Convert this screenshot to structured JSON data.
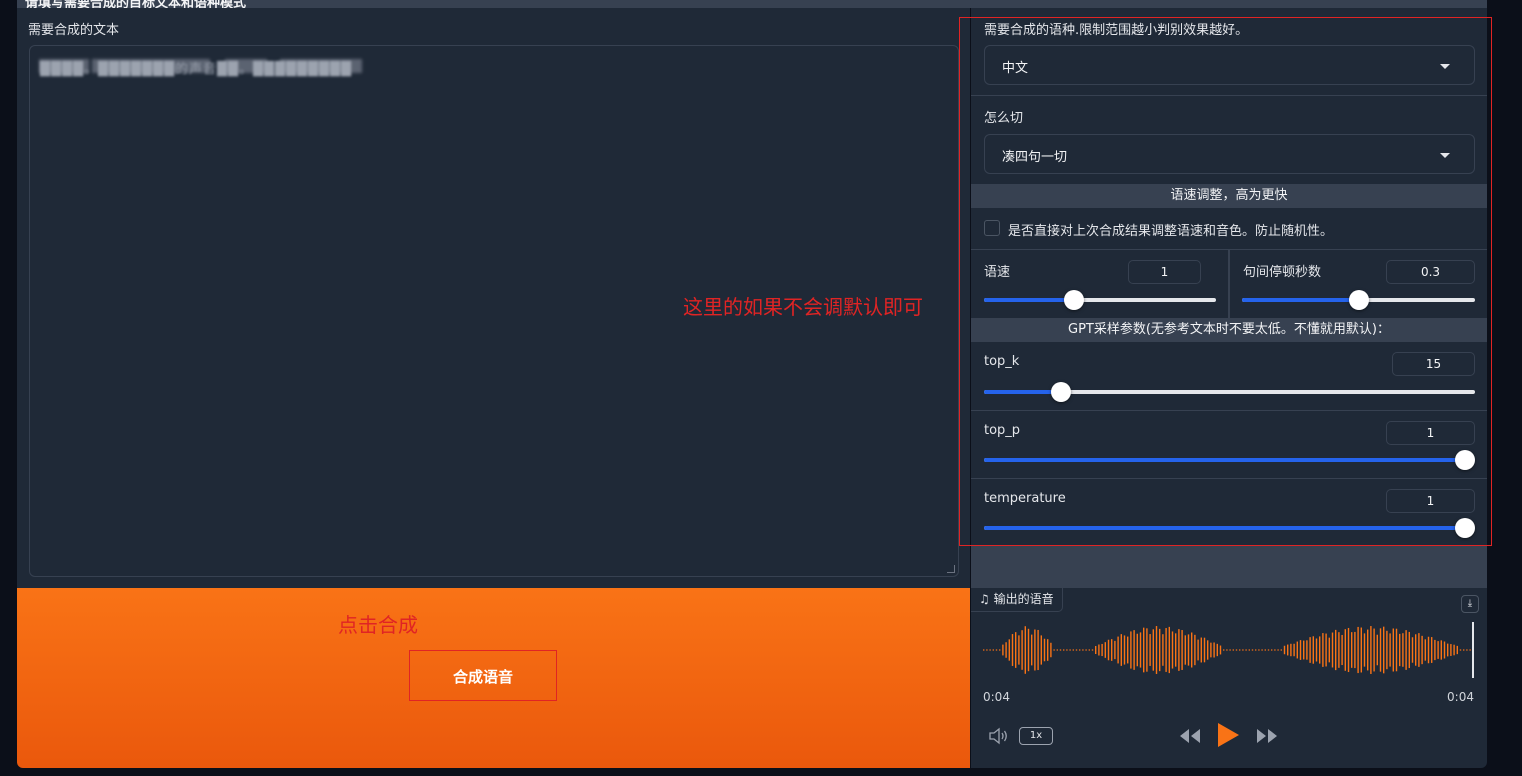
{
  "header": {
    "partial_title": "请填写需要合成的目标文本和语种模式"
  },
  "text_input": {
    "label": "需要合成的文本",
    "value": "████。███████的声音██。█████████"
  },
  "settings": {
    "language": {
      "label": "需要合成的语种.限制范围越小判别效果越好。",
      "value": "中文"
    },
    "cut": {
      "label": "怎么切",
      "value": "凑四句一切"
    },
    "speed_section": "语速调整，高为更快",
    "checkbox_label": "是否直接对上次合成结果调整语速和音色。防止随机性。",
    "speed": {
      "label": "语速",
      "value": "1",
      "fraction": 0.39
    },
    "pause": {
      "label": "句间停顿秒数",
      "value": "0.3",
      "fraction": 0.5
    },
    "gpt_section": "GPT采样参数(无参考文本时不要太低。不懂就用默认)：",
    "top_k": {
      "label": "top_k",
      "value": "15",
      "fraction": 0.156
    },
    "top_p": {
      "label": "top_p",
      "value": "1",
      "fraction": 1.0
    },
    "temperature": {
      "label": "temperature",
      "value": "1",
      "fraction": 1.0
    }
  },
  "actions": {
    "generate_label": "合成语音"
  },
  "audio": {
    "label": "输出的语音",
    "current_time": "0:04",
    "duration": "0:04",
    "speed": "1x",
    "wave_color": "#f97316"
  },
  "annotations": {
    "settings_note": "这里的如果不会调默认即可",
    "click_note": "点击合成",
    "color": "#e02424"
  },
  "colors": {
    "accent": "#2563eb",
    "generate": "#f97316"
  }
}
